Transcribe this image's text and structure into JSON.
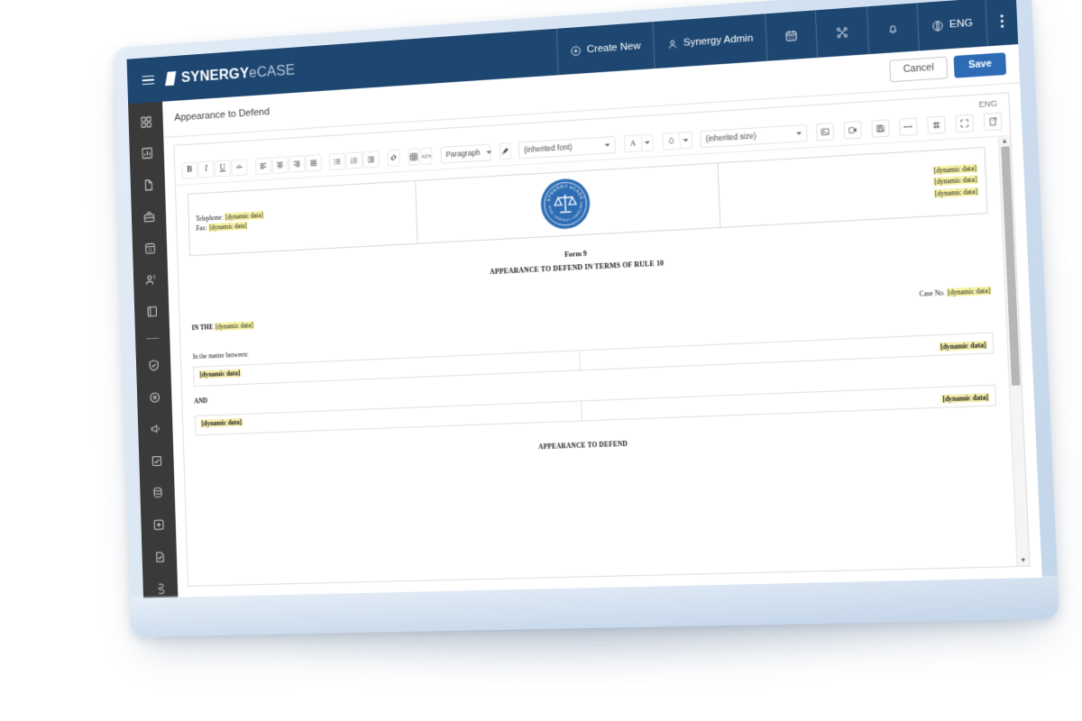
{
  "app": {
    "brand_bold": "SYNERGY",
    "brand_light": "eCASE",
    "menu_icon": "hamburger-icon"
  },
  "topnav": {
    "items": [
      {
        "label": "Create New",
        "icon": "plus-circle-icon"
      },
      {
        "label": "Synergy Admin",
        "icon": "user-icon"
      },
      {
        "label": "",
        "icon": "calendar-icon"
      },
      {
        "label": "",
        "icon": "network-nodes-icon"
      },
      {
        "label": "",
        "icon": "bell-icon"
      },
      {
        "label": "ENG",
        "icon": "globe-icon"
      },
      {
        "label": "",
        "icon": "kebab-menu-icon"
      }
    ]
  },
  "sidebar": {
    "items": [
      {
        "name": "dashboard",
        "icon": "grid-dashboard-icon"
      },
      {
        "name": "reports",
        "icon": "bar-chart-icon"
      },
      {
        "name": "documents",
        "icon": "document-icon"
      },
      {
        "name": "organisation",
        "icon": "briefcase-icon"
      },
      {
        "name": "calendar",
        "icon": "calendar-grid-icon"
      },
      {
        "name": "contacts",
        "icon": "person-icon"
      },
      {
        "name": "library",
        "icon": "book-icon"
      },
      {
        "name": "divider",
        "icon": "divider"
      },
      {
        "name": "compliance",
        "icon": "shield-check-icon"
      },
      {
        "name": "settings",
        "icon": "gear-icon"
      },
      {
        "name": "announcements",
        "icon": "megaphone-icon"
      },
      {
        "name": "tasks",
        "icon": "checklist-icon"
      },
      {
        "name": "database",
        "icon": "database-icon"
      },
      {
        "name": "add-new",
        "icon": "plus-square-icon"
      },
      {
        "name": "forms",
        "icon": "form-check-icon"
      },
      {
        "name": "archive",
        "icon": "archive-file-icon"
      }
    ]
  },
  "page": {
    "title": "Appearance to Defend",
    "cancel_label": "Cancel",
    "save_label": "Save",
    "language_label": "ENG"
  },
  "toolbar": {
    "bold": "B",
    "italic": "I",
    "underline": "U",
    "strikethrough": "S",
    "align_left": "align-left-icon",
    "align_center": "align-center-icon",
    "align_right": "align-right-icon",
    "align_justify": "align-justify-icon",
    "bullet_list": "bullet-list-icon",
    "numbered_list": "numbered-list-icon",
    "indent": "indent-icon",
    "link": "link-icon",
    "table": "table-icon",
    "source_code": "</>",
    "paragraph_style": "Paragraph",
    "clear_formatting": "eraser-icon",
    "font_family": "(inherited font)",
    "text_color": "A",
    "highlight_color": "droplet-icon",
    "font_size": "(inherited size)",
    "insert_image": "image-icon",
    "insert_video": "video-icon",
    "insert_file": "save-disk-icon",
    "horizontal_rule": "horizontal-rule-icon",
    "special_char": "special-character-icon",
    "fullscreen": "fullscreen-icon",
    "export": "export-icon"
  },
  "document": {
    "letterhead": {
      "telephone_label": "Telephone:",
      "telephone_value": "[dynamic data]",
      "fax_label": "Fax:",
      "fax_value": "[dynamic data]",
      "seal_text": "SYNERGY eCASE",
      "right_lines": [
        "[dynamic data]",
        "[dynamic data]",
        "[dynamic data]"
      ]
    },
    "form_number": "Form 9",
    "form_title": "APPEARANCE TO DEFEND IN TERMS OF RULE 10",
    "in_the_label": "IN THE",
    "in_the_value": "[dynamic data]",
    "case_no_label": "Case No.",
    "case_no_value": "[dynamic data]",
    "matter_label": "In the matter between:",
    "party_one": {
      "left": "[dynamic data]",
      "right": "[dynamic data]"
    },
    "and_label": "AND",
    "party_two": {
      "left": "[dynamic data]",
      "right": "[dynamic data]"
    },
    "appearance_heading": "APPEARANCE TO DEFEND"
  },
  "colors": {
    "header_navy": "#1d4671",
    "sidebar_dark": "#3a3a3a",
    "save_blue": "#2d6cb5",
    "highlight_yellow": "#f7f2a6",
    "seal_blue": "#2e6db4",
    "tablet_frame": "#d7e4f2"
  }
}
